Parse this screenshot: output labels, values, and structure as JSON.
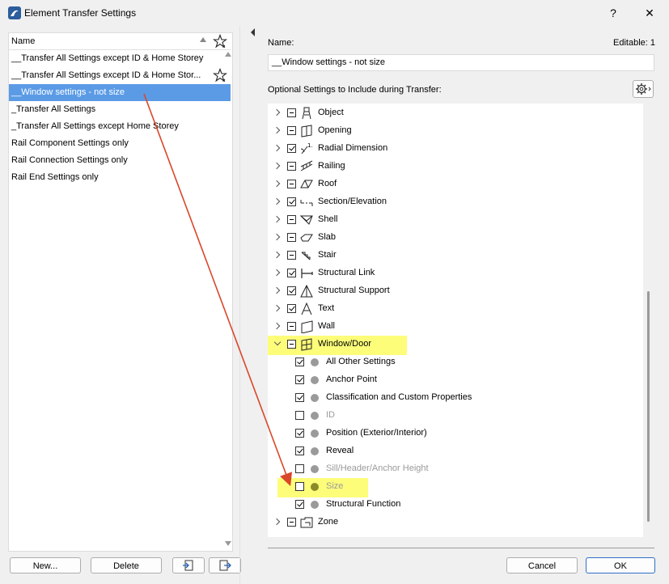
{
  "window": {
    "title": "Element Transfer Settings",
    "help": "?",
    "close": "✕"
  },
  "left": {
    "header": "Name",
    "items": [
      "__Transfer All Settings except ID & Home Storey",
      "__Transfer All Settings except ID & Home Stor...",
      "__Window settings - not size",
      "_Transfer All Settings",
      "_Transfer All Settings except Home Storey",
      "Rail Component Settings only",
      "Rail Connection Settings only",
      "Rail End Settings only"
    ],
    "selected_index": 2,
    "buttons": {
      "new": "New...",
      "delete": "Delete"
    }
  },
  "right": {
    "name_label": "Name:",
    "editable": "Editable: 1",
    "name_value": "__Window settings - not size",
    "optional_label": "Optional Settings to Include during Transfer:",
    "tree": [
      {
        "label": "Object",
        "state": "mixed",
        "icon": "object-icon",
        "level": 0
      },
      {
        "label": "Opening",
        "state": "mixed",
        "icon": "opening-icon",
        "level": 0
      },
      {
        "label": "Radial Dimension",
        "state": "checked",
        "icon": "radial-dimension-icon",
        "level": 0
      },
      {
        "label": "Railing",
        "state": "mixed",
        "icon": "railing-icon",
        "level": 0
      },
      {
        "label": "Roof",
        "state": "mixed",
        "icon": "roof-icon",
        "level": 0
      },
      {
        "label": "Section/Elevation",
        "state": "checked",
        "icon": "section-elevation-icon",
        "level": 0
      },
      {
        "label": "Shell",
        "state": "mixed",
        "icon": "shell-icon",
        "level": 0
      },
      {
        "label": "Slab",
        "state": "mixed",
        "icon": "slab-icon",
        "level": 0
      },
      {
        "label": "Stair",
        "state": "mixed",
        "icon": "stair-icon",
        "level": 0
      },
      {
        "label": "Structural Link",
        "state": "checked",
        "icon": "structural-link-icon",
        "level": 0
      },
      {
        "label": "Structural Support",
        "state": "checked",
        "icon": "structural-support-icon",
        "level": 0
      },
      {
        "label": "Text",
        "state": "checked",
        "icon": "text-icon",
        "level": 0
      },
      {
        "label": "Wall",
        "state": "mixed",
        "icon": "wall-icon",
        "level": 0
      },
      {
        "label": "Window/Door",
        "state": "mixed",
        "icon": "window-door-icon",
        "level": 0,
        "expanded": true,
        "highlight": true
      },
      {
        "label": "All Other Settings",
        "state": "checked",
        "level": 1
      },
      {
        "label": "Anchor Point",
        "state": "checked",
        "level": 1
      },
      {
        "label": "Classification and Custom Properties",
        "state": "checked",
        "level": 1
      },
      {
        "label": "ID",
        "state": "unchecked",
        "level": 1,
        "muted": true
      },
      {
        "label": "Position (Exterior/Interior)",
        "state": "checked",
        "level": 1
      },
      {
        "label": "Reveal",
        "state": "checked",
        "level": 1
      },
      {
        "label": "Sill/Header/Anchor Height",
        "state": "unchecked",
        "level": 1,
        "muted": true
      },
      {
        "label": "Size",
        "state": "unchecked",
        "level": 1,
        "muted": true,
        "highlight": true
      },
      {
        "label": "Structural Function",
        "state": "checked",
        "level": 1
      },
      {
        "label": "Zone",
        "state": "mixed",
        "icon": "zone-icon",
        "level": 0
      }
    ],
    "buttons": {
      "cancel": "Cancel",
      "ok": "OK"
    }
  },
  "colors": {
    "selection": "#5b9be6",
    "highlight": "#fdfd7a",
    "arrow": "#d9472a"
  }
}
